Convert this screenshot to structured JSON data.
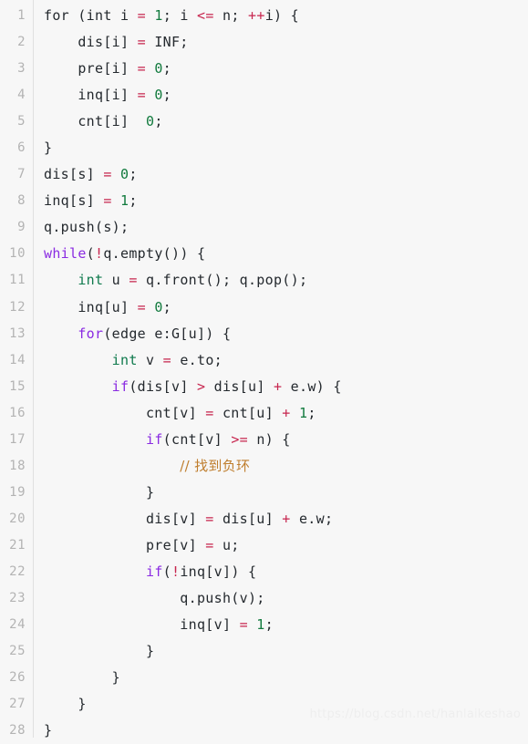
{
  "editor": {
    "language": "cpp",
    "background_color": "#f7f7f7",
    "gutter_divider_color": "#e0e0e0",
    "line_number_color": "#b3b3b3",
    "total_lines": 28,
    "colors": {
      "plain": "#24292e",
      "keyword": "#8a2be2",
      "type": "#0f7a4d",
      "number": "#117a3d",
      "operator": "#c7254e",
      "comment": "#bf7e2e"
    }
  },
  "watermark": {
    "text": "https://blog.csdn.net/hanlaikeshao"
  },
  "lines": [
    {
      "number": "1",
      "tokens": [
        {
          "t": "for (",
          "c": "plain"
        },
        {
          "t": "int",
          "c": "plain"
        },
        {
          "t": " i ",
          "c": "plain"
        },
        {
          "t": "=",
          "c": "operator"
        },
        {
          "t": " ",
          "c": "plain"
        },
        {
          "t": "1",
          "c": "number"
        },
        {
          "t": "; i ",
          "c": "plain"
        },
        {
          "t": "<=",
          "c": "operator"
        },
        {
          "t": " n; ",
          "c": "plain"
        },
        {
          "t": "++",
          "c": "operator"
        },
        {
          "t": "i) {",
          "c": "plain"
        }
      ]
    },
    {
      "number": "2",
      "tokens": [
        {
          "t": "    dis[i] ",
          "c": "plain"
        },
        {
          "t": "=",
          "c": "operator"
        },
        {
          "t": " INF;",
          "c": "plain"
        }
      ]
    },
    {
      "number": "3",
      "tokens": [
        {
          "t": "    pre[i] ",
          "c": "plain"
        },
        {
          "t": "=",
          "c": "operator"
        },
        {
          "t": " ",
          "c": "plain"
        },
        {
          "t": "0",
          "c": "number"
        },
        {
          "t": ";",
          "c": "plain"
        }
      ]
    },
    {
      "number": "4",
      "tokens": [
        {
          "t": "    inq[i] ",
          "c": "plain"
        },
        {
          "t": "=",
          "c": "operator"
        },
        {
          "t": " ",
          "c": "plain"
        },
        {
          "t": "0",
          "c": "number"
        },
        {
          "t": ";",
          "c": "plain"
        }
      ]
    },
    {
      "number": "5",
      "tokens": [
        {
          "t": "    cnt[i]  ",
          "c": "plain"
        },
        {
          "t": "0",
          "c": "number"
        },
        {
          "t": ";",
          "c": "plain"
        }
      ]
    },
    {
      "number": "6",
      "tokens": [
        {
          "t": "}",
          "c": "plain"
        }
      ]
    },
    {
      "number": "7",
      "tokens": [
        {
          "t": "dis[s] ",
          "c": "plain"
        },
        {
          "t": "=",
          "c": "operator"
        },
        {
          "t": " ",
          "c": "plain"
        },
        {
          "t": "0",
          "c": "number"
        },
        {
          "t": ";",
          "c": "plain"
        }
      ]
    },
    {
      "number": "8",
      "tokens": [
        {
          "t": "inq[s] ",
          "c": "plain"
        },
        {
          "t": "=",
          "c": "operator"
        },
        {
          "t": " ",
          "c": "plain"
        },
        {
          "t": "1",
          "c": "number"
        },
        {
          "t": ";",
          "c": "plain"
        }
      ]
    },
    {
      "number": "9",
      "tokens": [
        {
          "t": "q.push(s);",
          "c": "plain"
        }
      ]
    },
    {
      "number": "10",
      "tokens": [
        {
          "t": "while",
          "c": "keyword"
        },
        {
          "t": "(",
          "c": "plain"
        },
        {
          "t": "!",
          "c": "operator"
        },
        {
          "t": "q.empty()) {",
          "c": "plain"
        }
      ]
    },
    {
      "number": "11",
      "tokens": [
        {
          "t": "    ",
          "c": "plain"
        },
        {
          "t": "int",
          "c": "type"
        },
        {
          "t": " u ",
          "c": "plain"
        },
        {
          "t": "=",
          "c": "operator"
        },
        {
          "t": " q.front(); q.pop();",
          "c": "plain"
        }
      ]
    },
    {
      "number": "12",
      "tokens": [
        {
          "t": "    inq[u] ",
          "c": "plain"
        },
        {
          "t": "=",
          "c": "operator"
        },
        {
          "t": " ",
          "c": "plain"
        },
        {
          "t": "0",
          "c": "number"
        },
        {
          "t": ";",
          "c": "plain"
        }
      ]
    },
    {
      "number": "13",
      "tokens": [
        {
          "t": "    ",
          "c": "plain"
        },
        {
          "t": "for",
          "c": "keyword"
        },
        {
          "t": "(edge e:G[u]) {",
          "c": "plain"
        }
      ]
    },
    {
      "number": "14",
      "tokens": [
        {
          "t": "        ",
          "c": "plain"
        },
        {
          "t": "int",
          "c": "type"
        },
        {
          "t": " v ",
          "c": "plain"
        },
        {
          "t": "=",
          "c": "operator"
        },
        {
          "t": " e.to;",
          "c": "plain"
        }
      ]
    },
    {
      "number": "15",
      "tokens": [
        {
          "t": "        ",
          "c": "plain"
        },
        {
          "t": "if",
          "c": "keyword"
        },
        {
          "t": "(dis[v] ",
          "c": "plain"
        },
        {
          "t": ">",
          "c": "operator"
        },
        {
          "t": " dis[u] ",
          "c": "plain"
        },
        {
          "t": "+",
          "c": "operator"
        },
        {
          "t": " e.w) {",
          "c": "plain"
        }
      ]
    },
    {
      "number": "16",
      "tokens": [
        {
          "t": "            cnt[v] ",
          "c": "plain"
        },
        {
          "t": "=",
          "c": "operator"
        },
        {
          "t": " cnt[u] ",
          "c": "plain"
        },
        {
          "t": "+",
          "c": "operator"
        },
        {
          "t": " ",
          "c": "plain"
        },
        {
          "t": "1",
          "c": "number"
        },
        {
          "t": ";",
          "c": "plain"
        }
      ]
    },
    {
      "number": "17",
      "tokens": [
        {
          "t": "            ",
          "c": "plain"
        },
        {
          "t": "if",
          "c": "keyword"
        },
        {
          "t": "(cnt[v] ",
          "c": "plain"
        },
        {
          "t": ">=",
          "c": "operator"
        },
        {
          "t": " n) {",
          "c": "plain"
        }
      ]
    },
    {
      "number": "18",
      "tokens": [
        {
          "t": "                ",
          "c": "plain"
        },
        {
          "t": "// 找到负环",
          "c": "comment"
        }
      ]
    },
    {
      "number": "19",
      "tokens": [
        {
          "t": "            }",
          "c": "plain"
        }
      ]
    },
    {
      "number": "20",
      "tokens": [
        {
          "t": "            dis[v] ",
          "c": "plain"
        },
        {
          "t": "=",
          "c": "operator"
        },
        {
          "t": " dis[u] ",
          "c": "plain"
        },
        {
          "t": "+",
          "c": "operator"
        },
        {
          "t": " e.w;",
          "c": "plain"
        }
      ]
    },
    {
      "number": "21",
      "tokens": [
        {
          "t": "            pre[v] ",
          "c": "plain"
        },
        {
          "t": "=",
          "c": "operator"
        },
        {
          "t": " u;",
          "c": "plain"
        }
      ]
    },
    {
      "number": "22",
      "tokens": [
        {
          "t": "            ",
          "c": "plain"
        },
        {
          "t": "if",
          "c": "keyword"
        },
        {
          "t": "(",
          "c": "plain"
        },
        {
          "t": "!",
          "c": "operator"
        },
        {
          "t": "inq[v]) {",
          "c": "plain"
        }
      ]
    },
    {
      "number": "23",
      "tokens": [
        {
          "t": "                q.push(v);",
          "c": "plain"
        }
      ]
    },
    {
      "number": "24",
      "tokens": [
        {
          "t": "                inq[v] ",
          "c": "plain"
        },
        {
          "t": "=",
          "c": "operator"
        },
        {
          "t": " ",
          "c": "plain"
        },
        {
          "t": "1",
          "c": "number"
        },
        {
          "t": ";",
          "c": "plain"
        }
      ]
    },
    {
      "number": "25",
      "tokens": [
        {
          "t": "            }",
          "c": "plain"
        }
      ]
    },
    {
      "number": "26",
      "tokens": [
        {
          "t": "        }",
          "c": "plain"
        }
      ]
    },
    {
      "number": "27",
      "tokens": [
        {
          "t": "    }",
          "c": "plain"
        }
      ]
    },
    {
      "number": "28",
      "tokens": [
        {
          "t": "}",
          "c": "plain"
        }
      ]
    }
  ]
}
